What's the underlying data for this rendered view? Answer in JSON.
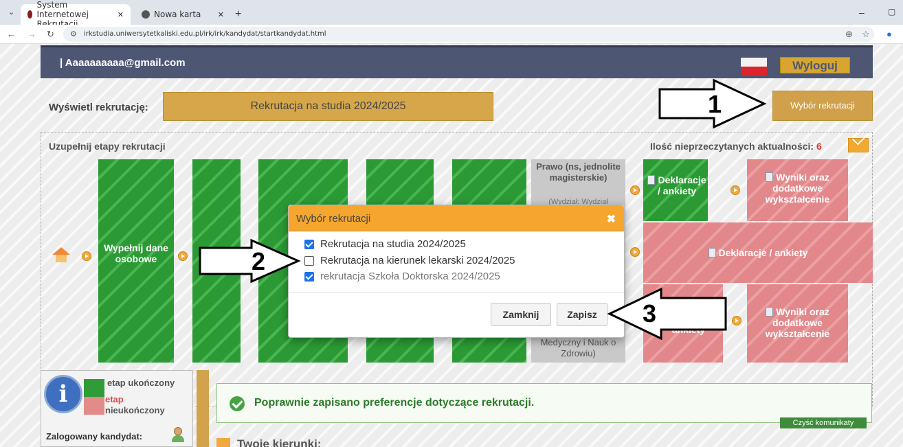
{
  "browser": {
    "tabs": [
      {
        "label": "System Internetowej Rekrutacji",
        "active": true
      },
      {
        "label": "Nowa karta",
        "active": false
      }
    ],
    "url": "irkstudia.uniwersytetkaliski.edu.pl/irk/irk/kandydat/startkandydat.html"
  },
  "header": {
    "email": "| Aaaaaaaaaa@gmail.com",
    "logout_label": "Wyloguj"
  },
  "recruitment": {
    "show_label": "Wyświetl rekrutację:",
    "current": "Rekrutacja na studia 2024/2025",
    "select_button": "Wybór rekrutacji"
  },
  "steps": {
    "heading": "Uzupełnij etapy rekrutacji",
    "unread_label": "Ilość nieprzeczytanych aktualności:",
    "unread_count": "6",
    "personal_data": "Wypełnij dane osobowe",
    "program_top": "Prawo (ns, jednolite magisterskie)",
    "program_top_faculty": "(Wydział: Wydział",
    "program_bottom_faculty": "Medyczny i Nauk o Zdrowiu)",
    "declarations_short": "Deklaracje / ankiety",
    "declarations_long": "Deklaracje / ankiety",
    "declarations_partial": "ankiety",
    "results": "Wyniki oraz dodatkowe wykształcenie"
  },
  "legend": {
    "done": "etap ukończony",
    "not_done_1": "etap",
    "not_done_2": "nieukończony",
    "logged_label": "Zalogowany kandydat:"
  },
  "messages": {
    "success": "Poprawnie zapisano preferencje dotyczące rekrutacji.",
    "clear_button": "Czyść komunikaty",
    "your_programs": "Twoje kierunki:"
  },
  "modal": {
    "title": "Wybór rekrutacji",
    "options": [
      {
        "label": "Rekrutacja na studia 2024/2025",
        "checked": true
      },
      {
        "label": "Rekrutacja na kierunek lekarski 2024/2025",
        "checked": false
      },
      {
        "label": "rekrutacja Szkoła Doktorska 2024/2025",
        "checked": true
      }
    ],
    "close_button": "Zamknij",
    "save_button": "Zapisz"
  },
  "annotations": {
    "n1": "1",
    "n2": "2",
    "n3": "3"
  },
  "colors": {
    "accent": "#f4a62e",
    "done": "#2b9a35",
    "not_done": "#e2878a",
    "header": "#4d5774"
  }
}
